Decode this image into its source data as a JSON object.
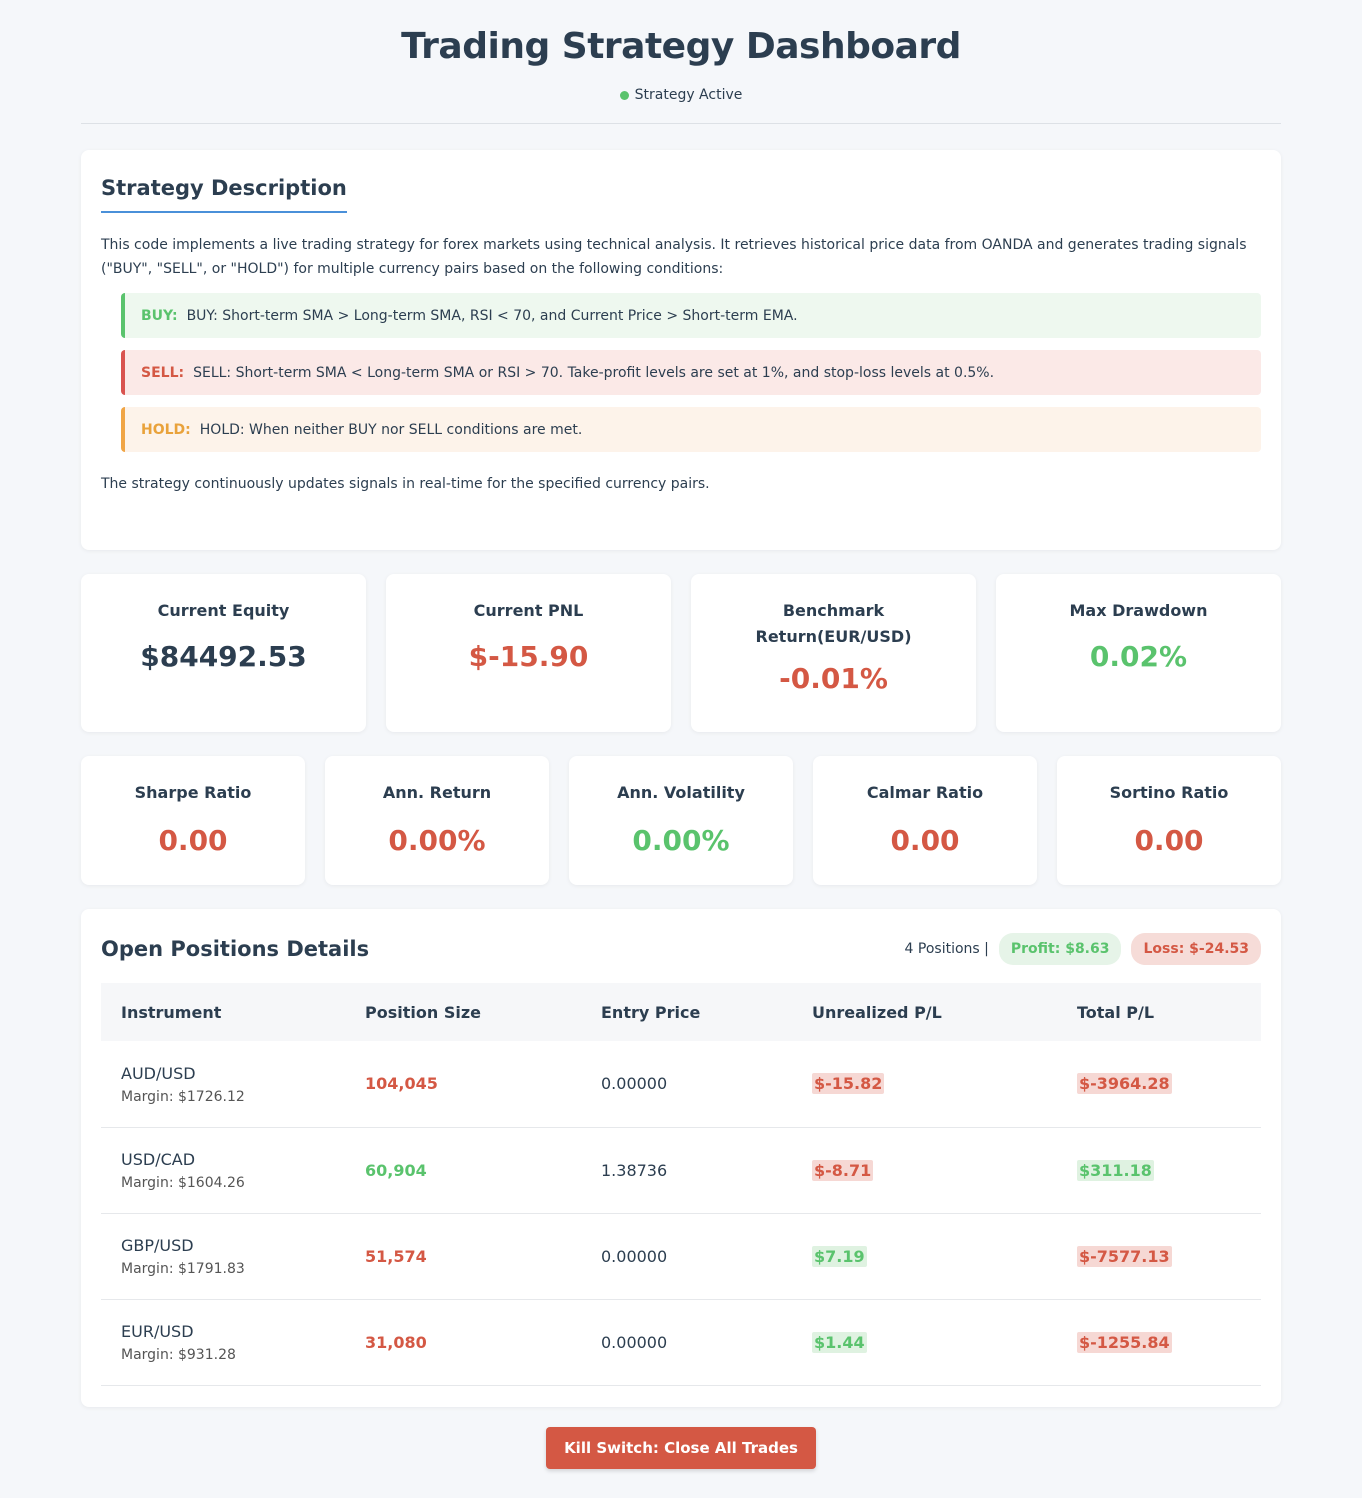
{
  "header": {
    "title": "Trading Strategy Dashboard",
    "status": "Strategy Active",
    "status_color": "#5ac36d"
  },
  "description": {
    "title": "Strategy Description",
    "intro": "This code implements a live trading strategy for forex markets using technical analysis. It retrieves historical price data from OANDA and generates trading signals (\"BUY\", \"SELL\", or \"HOLD\") for multiple currency pairs based on the following conditions:",
    "signals": [
      {
        "label": "BUY:",
        "text": "BUY: Short-term SMA > Long-term SMA, RSI < 70, and Current Price > Short-term EMA."
      },
      {
        "label": "SELL:",
        "text": "SELL: Short-term SMA < Long-term SMA or RSI > 70. Take-profit levels are set at 1%, and stop-loss levels at 0.5%."
      },
      {
        "label": "HOLD:",
        "text": "HOLD: When neither BUY nor SELL conditions are met."
      }
    ],
    "outro": "The strategy continuously updates signals in real-time for the specified currency pairs."
  },
  "metrics_primary": [
    {
      "title": "Current Equity",
      "value": "$84492.53"
    },
    {
      "title": "Current PNL",
      "value": "$-15.90"
    },
    {
      "title": "Benchmark Return(EUR/USD)",
      "value": "-0.01%"
    },
    {
      "title": "Max Drawdown",
      "value": "0.02%"
    }
  ],
  "metrics_secondary": [
    {
      "title": "Sharpe Ratio",
      "value": "0.00"
    },
    {
      "title": "Ann. Return",
      "value": "0.00%"
    },
    {
      "title": "Ann. Volatility",
      "value": "0.00%"
    },
    {
      "title": "Calmar Ratio",
      "value": "0.00"
    },
    {
      "title": "Sortino Ratio",
      "value": "0.00"
    }
  ],
  "positions": {
    "title": "Open Positions Details",
    "count_text": "4 Positions |",
    "profit": "Profit: $8.63",
    "loss": "Loss: $-24.53",
    "columns": [
      "Instrument",
      "Position Size",
      "Entry Price",
      "Unrealized P/L",
      "Total P/L"
    ],
    "rows": [
      {
        "instrument": "AUD/USD",
        "margin": "Margin: $1726.12",
        "size": "104,045",
        "entry": "0.00000",
        "unrealized": "$-15.82",
        "total": "$-3964.28"
      },
      {
        "instrument": "USD/CAD",
        "margin": "Margin: $1604.26",
        "size": "60,904",
        "entry": "1.38736",
        "unrealized": "$-8.71",
        "total": "$311.18"
      },
      {
        "instrument": "GBP/USD",
        "margin": "Margin: $1791.83",
        "size": "51,574",
        "entry": "0.00000",
        "unrealized": "$7.19",
        "total": "$-7577.13"
      },
      {
        "instrument": "EUR/USD",
        "margin": "Margin: $931.28",
        "size": "31,080",
        "entry": "0.00000",
        "unrealized": "$1.44",
        "total": "$-1255.84"
      }
    ]
  },
  "kill_switch": {
    "label": "Kill Switch: Close All Trades"
  },
  "colors": {
    "positive": "#5ac36d",
    "negative": "#d45844",
    "accent": "#4a90d9"
  }
}
